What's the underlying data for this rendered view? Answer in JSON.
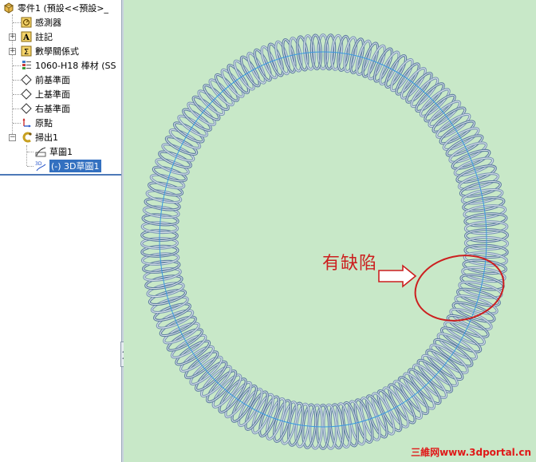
{
  "tree": {
    "root_label": "零件1 (預設<<預設>_",
    "items": [
      {
        "label": "感測器"
      },
      {
        "label": "註記"
      },
      {
        "label": "數學關係式"
      },
      {
        "label": "1060-H18 棒材 (SS"
      },
      {
        "label": "前基準面"
      },
      {
        "label": "上基準面"
      },
      {
        "label": "右基準面"
      },
      {
        "label": "原點"
      },
      {
        "label": "掃出1"
      },
      {
        "label": "草圖1"
      },
      {
        "label": "(-) 3D草圖1"
      }
    ],
    "icon_names": [
      "part-icon",
      "sensor-icon",
      "annotation-icon",
      "equation-icon",
      "material-icon",
      "plane-icon",
      "plane-icon",
      "plane-icon",
      "origin-icon",
      "sweep-icon",
      "sketch-icon",
      "3d-sketch-icon"
    ],
    "icon_text": {
      "annotation": "A",
      "equation": "Σ",
      "sketch3d": "3D"
    }
  },
  "viewport": {
    "annotation": "有缺陷",
    "watermark": "三維网www.3dportal.cn",
    "colors": {
      "background": "#c8e8c8",
      "spring": "#5f7f9f",
      "annotation": "#cc1f1f",
      "highlight": "#3370c0"
    }
  }
}
